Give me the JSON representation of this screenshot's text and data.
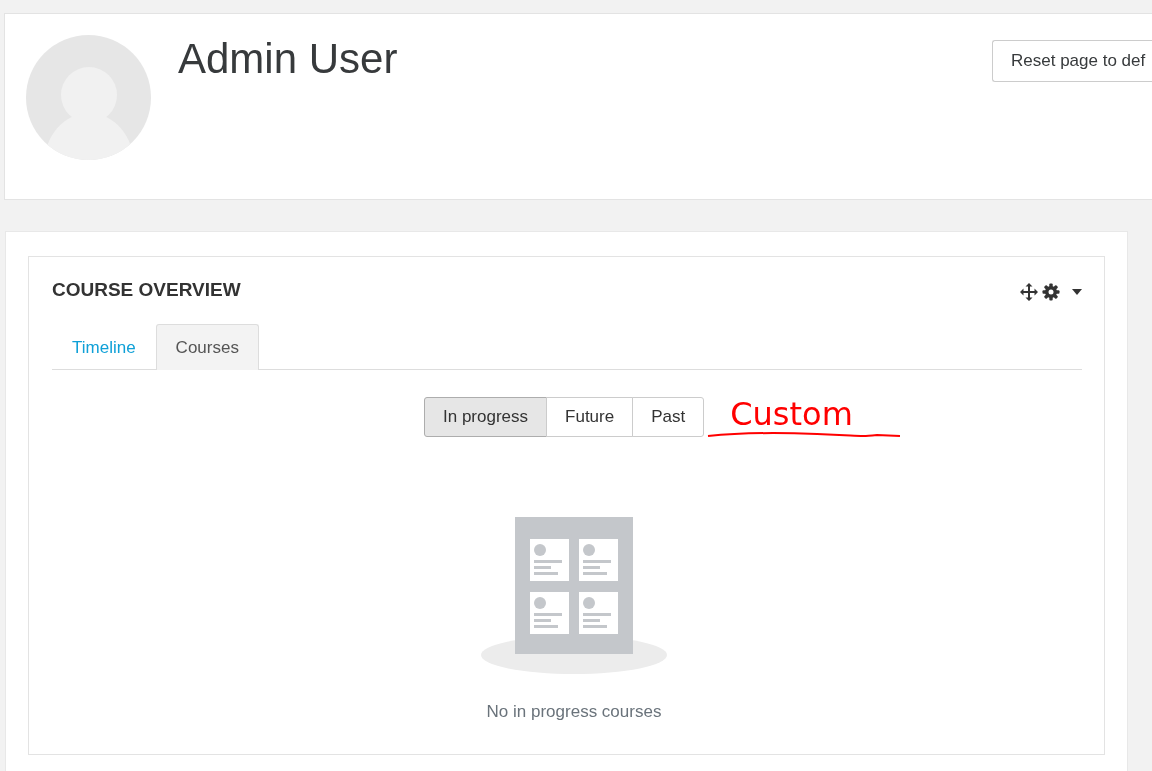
{
  "header": {
    "title": "Admin User",
    "reset_button": "Reset page to def"
  },
  "block": {
    "title": "COURSE OVERVIEW",
    "tabs": [
      {
        "label": "Timeline",
        "selected": false
      },
      {
        "label": "Courses",
        "selected": true
      }
    ],
    "filters": [
      {
        "label": "In progress",
        "selected": true
      },
      {
        "label": "Future",
        "selected": false
      },
      {
        "label": "Past",
        "selected": false
      }
    ],
    "annotation": "Custom",
    "empty_message": "No in progress courses"
  }
}
